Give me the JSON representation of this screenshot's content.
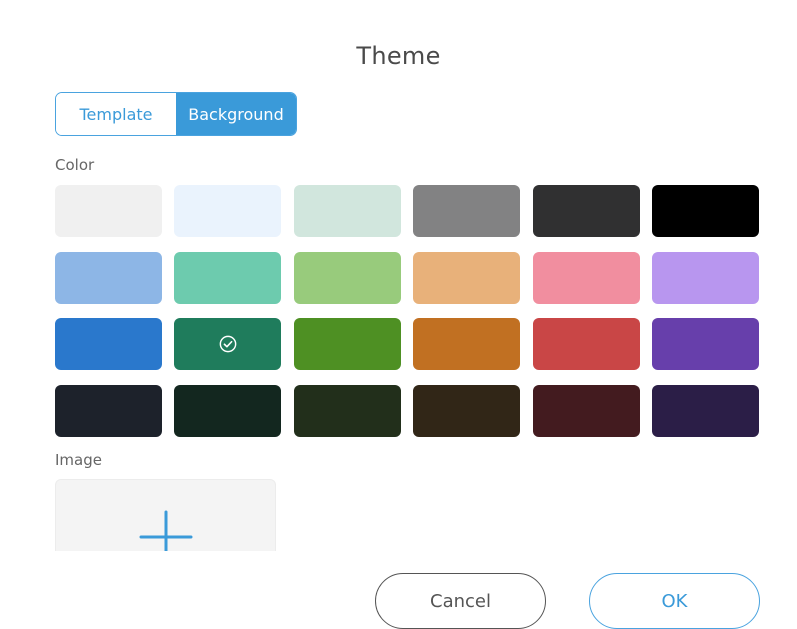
{
  "dialog": {
    "title": "Theme",
    "tabs": [
      {
        "label": "Template",
        "active": false
      },
      {
        "label": "Background",
        "active": true
      }
    ],
    "color_section_label": "Color",
    "image_section_label": "Image",
    "colors": [
      "#f0f0f0",
      "#eaf3fd",
      "#d1e6dd",
      "#828283",
      "#303031",
      "#000000",
      "#8db6e6",
      "#6dcbae",
      "#98cb7c",
      "#e8b17a",
      "#f18e9f",
      "#b896ef",
      "#2a78cc",
      "#1f7c5c",
      "#4e9023",
      "#c17022",
      "#c94646",
      "#673fab",
      "#1d222b",
      "#13271f",
      "#222f1b",
      "#312617",
      "#431b1f",
      "#2b1e47"
    ],
    "selected_color_index": 13,
    "accent_color": "#3a9ad9",
    "buttons": {
      "cancel_label": "Cancel",
      "ok_label": "OK"
    }
  }
}
